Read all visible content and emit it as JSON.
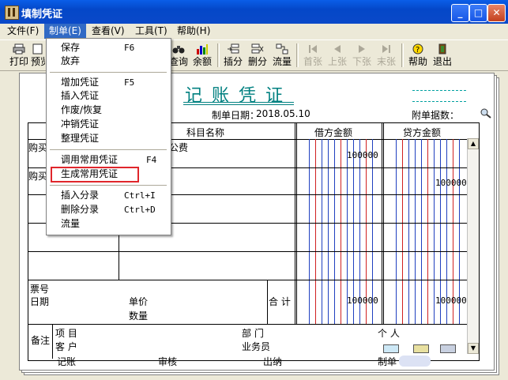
{
  "window": {
    "title": "填制凭证",
    "min": "_",
    "max": "□",
    "close": "✕"
  },
  "menubar": [
    {
      "label": "文件(F)"
    },
    {
      "label": "制单(E)"
    },
    {
      "label": "查看(V)"
    },
    {
      "label": "工具(T)"
    },
    {
      "label": "帮助(H)"
    }
  ],
  "toolbar": {
    "print": "打印",
    "preview": "预览",
    "query": "查询",
    "balance": "余额",
    "insert": "插分",
    "delete": "删分",
    "flow": "流量",
    "first": "首张",
    "prev": "上张",
    "next": "下张",
    "last": "末张",
    "help": "帮助",
    "exit": "退出"
  },
  "menu": {
    "save": "保存",
    "save_sc": "F6",
    "discard": "放弃",
    "add": "增加凭证",
    "add_sc": "F5",
    "insert_voucher": "插入凭证",
    "void": "作废/恢复",
    "reverse": "冲销凭证",
    "arrange": "整理凭证",
    "call_common": "调用常用凭证",
    "call_common_sc": "F4",
    "gen_common": "生成常用凭证",
    "insert_entry": "插入分录",
    "insert_entry_sc": "Ctrl+I",
    "delete_entry": "删除分录",
    "delete_entry_sc": "Ctrl+D",
    "flow": "流量"
  },
  "voucher": {
    "title": "记账凭证",
    "date_label": "制单日期：",
    "date": "2018.05.10",
    "attach_label": "附单据数：",
    "col_subject": "科目名称",
    "col_debit": "借方金额",
    "col_credit": "贷方金额",
    "rows": [
      {
        "summary": "购买",
        "subject": "公费",
        "debit": "100000",
        "credit": ""
      },
      {
        "summary": "购买",
        "subject": "",
        "debit": "",
        "credit": "100000"
      }
    ],
    "ticket_label": "票号",
    "date_row_label": "日期",
    "price_label": "单价",
    "qty_label": "数量",
    "total_label": "合 计",
    "total_debit": "100000",
    "total_credit": "100000",
    "remark_label": "备注",
    "project_label": "项    目",
    "customer_label": "客    户",
    "dept_label": "部    门",
    "salesman_label": "业务员",
    "person_label": "个    人",
    "footer": {
      "post": "记账",
      "audit": "审核",
      "cashier": "出纳",
      "maker": "制单"
    }
  },
  "colors": {
    "title_teal": "#008080",
    "highlight_red": "#e0262b",
    "menu_active": "#316ac5"
  }
}
